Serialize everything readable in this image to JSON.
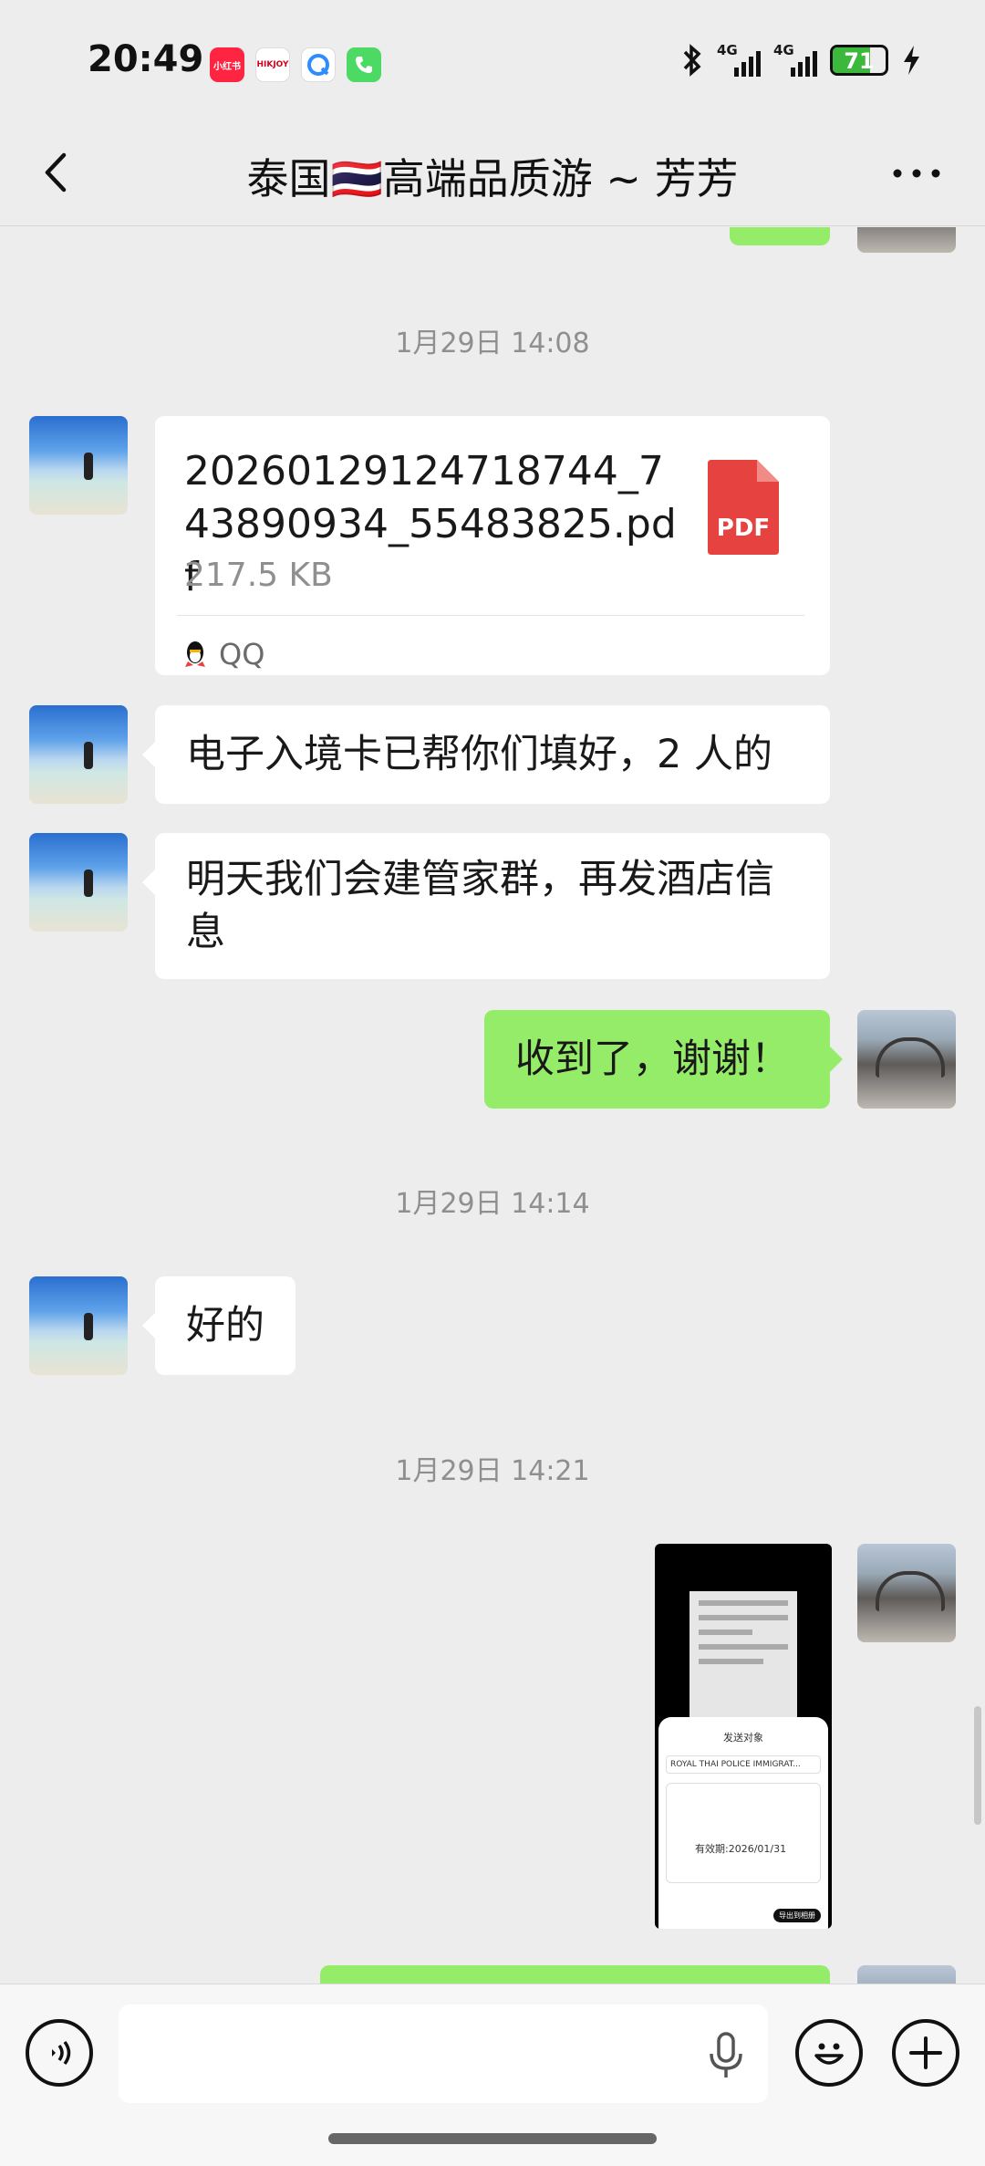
{
  "status_bar": {
    "time": "20:49",
    "apps": [
      "小红书",
      "HIKJOY"
    ],
    "network_labels": [
      "4G",
      "4G"
    ],
    "battery_percent": "71"
  },
  "header": {
    "title": "泰国🇹🇭高端品质游 ~ 芳芳"
  },
  "messages": {
    "ts1": "1月29日 14:08",
    "file": {
      "name": "20260129124718744_743890934_55483825.pdf",
      "size": "217.5 KB",
      "icon_label": "PDF",
      "source": "QQ"
    },
    "msg1": "电子入境卡已帮你们填好，2 人的",
    "msg2": "明天我们会建管家群，再发酒店信息",
    "reply1": "收到了，谢谢！",
    "ts2": "1月29日 14:14",
    "msg3": "好的",
    "ts3": "1月29日 14:21",
    "screenshot": {
      "sheet_title": "发送对象",
      "select_text": "ROYAL THAI POLICE IMMIGRAT...",
      "date_text": "有效期:2026/01/31",
      "export_label": "导出到相册"
    }
  }
}
